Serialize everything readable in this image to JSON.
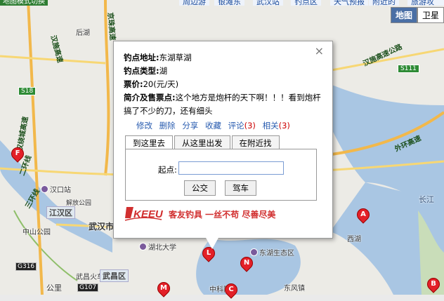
{
  "top_nav": [
    "周边游",
    "银滩东",
    "武汉站",
    "钓点区",
    "天气预报",
    "附近的",
    "旅游攻略"
  ],
  "top_left_button": "地图模式切换",
  "map_type": {
    "map": "地图",
    "satellite": "卫星"
  },
  "map_labels": {
    "places": [
      "后湖",
      "汉口站",
      "江汉区",
      "中山公园",
      "武汉市",
      "湖北大学",
      "东湖生态区",
      "武昌火车站",
      "武昌区",
      "中科院",
      "东风镇",
      "西湖",
      "长江",
      "解放公园"
    ],
    "districts": [
      "江汉区",
      "武昌区"
    ],
    "roads": [
      "汉施高速",
      "二环线",
      "三环线",
      "外环高速",
      "汉施高速公路",
      "京珠高速",
      "武汉绕城高速"
    ],
    "highway_codes": [
      "S18",
      "S111",
      "G316",
      "G107"
    ],
    "misc": [
      "长江",
      "公里"
    ]
  },
  "markers": [
    "F",
    "A",
    "L",
    "N",
    "M",
    "C",
    "B"
  ],
  "info_window": {
    "close": "×",
    "fields": [
      {
        "label": "钓点地址:",
        "value": "东湖草湖"
      },
      {
        "label": "钓点类型:",
        "value": "湖"
      },
      {
        "label": "票价:",
        "value": "20(元/天)"
      },
      {
        "label": "简介及售票点:",
        "value": "这个地方是炮杆的天下啊！！！看到炮杆搞了不少的刀，还有细头"
      }
    ],
    "actions": [
      {
        "label": "修改"
      },
      {
        "label": "删除"
      },
      {
        "label": "分享"
      },
      {
        "label": "收藏"
      },
      {
        "label": "评论",
        "count": "(3)"
      },
      {
        "label": "相关",
        "count": "(3)"
      }
    ],
    "tabs": [
      "到这里去",
      "从这里出发",
      "在附近找"
    ],
    "start_label": "起点:",
    "start_value": "",
    "buttons": {
      "bus": "公交",
      "drive": "驾车"
    },
    "brand_logo": "KEEU",
    "slogan": "客友钓具 一丝不苟 尽善尽美"
  }
}
